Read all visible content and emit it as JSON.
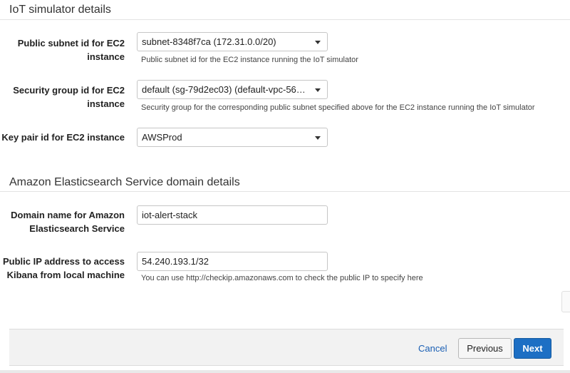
{
  "iot_section": {
    "title": "IoT simulator details",
    "subnet": {
      "label": "Public subnet id for EC2 instance",
      "value": "subnet-8348f7ca (172.31.0.0/20)",
      "help": "Public subnet id for the EC2 instance running the IoT simulator"
    },
    "security_group": {
      "label": "Security group id for EC2 instance",
      "value": "default (sg-79d2ec03) (default-vpc-560…",
      "help": "Security group for the corresponding public subnet specified above for the EC2 instance running the IoT simulator"
    },
    "key_pair": {
      "label": "Key pair id for EC2 instance",
      "value": "AWSProd"
    }
  },
  "es_section": {
    "title": "Amazon Elasticsearch Service domain details",
    "domain_name": {
      "label": "Domain name for Amazon Elasticsearch Service",
      "value": "iot-alert-stack"
    },
    "public_ip": {
      "label": "Public IP address to access Kibana from local machine",
      "value": "54.240.193.1/32",
      "help": "You can use http://checkip.amazonaws.com to check the public IP to specify here"
    }
  },
  "footer": {
    "cancel_label": "Cancel",
    "previous_label": "Previous",
    "next_label": "Next"
  },
  "colors": {
    "primary_button": "#1d6fc4",
    "link": "#1a5fb4",
    "footer_bg": "#f2f2f2"
  },
  "icons": {
    "dropdown": "chevron-down-icon"
  }
}
